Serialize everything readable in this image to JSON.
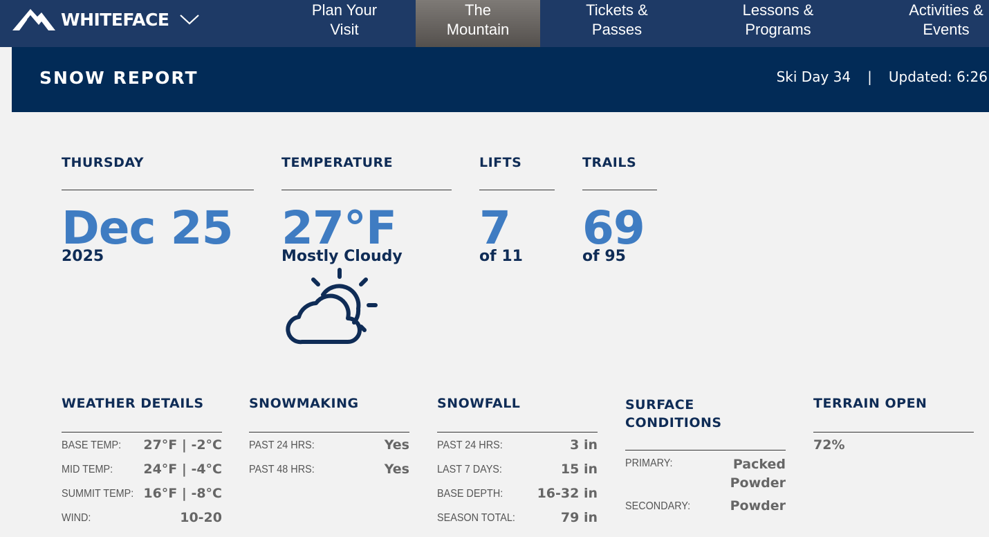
{
  "nav": {
    "brand": "WHITEFACE",
    "items": [
      {
        "label": "Plan Your Visit",
        "line1": "Plan Your",
        "line2": "Visit"
      },
      {
        "label": "The Mountain",
        "line1": "The",
        "line2": "Mountain",
        "active": true
      },
      {
        "label": "Tickets & Passes",
        "line1": "Tickets &",
        "line2": "Passes"
      },
      {
        "label": "Lessons & Programs",
        "line1": "Lessons &",
        "line2": "Programs"
      },
      {
        "label": "Activities & Events",
        "line1": "Activities &",
        "line2": "Events"
      }
    ]
  },
  "report": {
    "title": "SNOW REPORT",
    "ski_day": "Ski Day 34",
    "separator": "|",
    "updated": "Updated: 6:26"
  },
  "stats": {
    "day": {
      "head": "THURSDAY",
      "big": "Dec 25",
      "sub": "2025"
    },
    "temperature": {
      "head": "TEMPERATURE",
      "big": "27°F",
      "sub": "Mostly Cloudy",
      "icon": "partly-cloudy-icon"
    },
    "lifts": {
      "head": "LIFTS",
      "big": "7",
      "sub": "of 11"
    },
    "trails": {
      "head": "TRAILS",
      "big": "69",
      "sub": "of 95"
    }
  },
  "details": {
    "weather": {
      "head": "WEATHER DETAILS",
      "rows": [
        {
          "label": "BASE TEMP:",
          "value": "27°F | -2°C"
        },
        {
          "label": "MID TEMP:",
          "value": "24°F | -4°C"
        },
        {
          "label": "SUMMIT TEMP:",
          "value": "16°F | -8°C"
        },
        {
          "label": "WIND:",
          "value": "10-20"
        }
      ]
    },
    "snowmaking": {
      "head": "SNOWMAKING",
      "rows": [
        {
          "label": "PAST 24 HRS:",
          "value": "Yes"
        },
        {
          "label": "PAST 48 HRS:",
          "value": "Yes"
        }
      ]
    },
    "snowfall": {
      "head": "SNOWFALL",
      "rows": [
        {
          "label": "PAST 24 HRS:",
          "value": "3 in"
        },
        {
          "label": "LAST 7 DAYS:",
          "value": "15 in"
        },
        {
          "label": "BASE DEPTH:",
          "value": "16-32 in"
        },
        {
          "label": "SEASON TOTAL:",
          "value": "79 in"
        }
      ]
    },
    "surface": {
      "head_line1": "SURFACE",
      "head_line2": "CONDITIONS",
      "rows": [
        {
          "label": "PRIMARY:",
          "value_line1": "Packed",
          "value_line2": "Powder"
        },
        {
          "label": "SECONDARY:",
          "value": "Powder"
        }
      ]
    },
    "terrain": {
      "head": "TERRAIN OPEN",
      "value": "72%"
    }
  },
  "colors": {
    "nav": "#1e3a66",
    "bar": "#022b57",
    "accent": "#3f7cc2",
    "text": "#0f2c56",
    "background": "#f2f2f2"
  }
}
